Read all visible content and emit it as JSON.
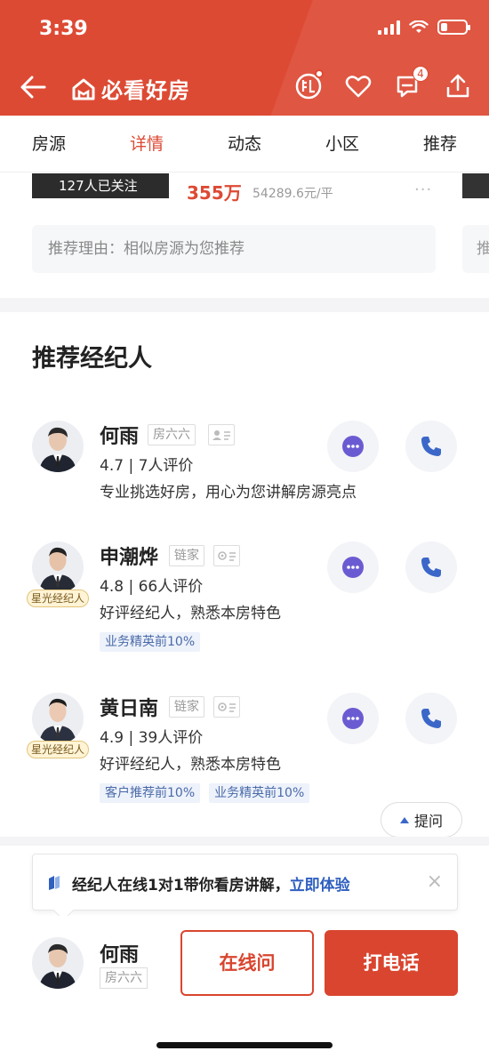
{
  "status_bar": {
    "time": "3:39"
  },
  "app": {
    "logo_text": "必看好房"
  },
  "header": {
    "message_count": "4"
  },
  "tabs": [
    {
      "label": "房源",
      "active": false
    },
    {
      "label": "详情",
      "active": true
    },
    {
      "label": "动态",
      "active": false
    },
    {
      "label": "小区",
      "active": false
    },
    {
      "label": "推荐",
      "active": false
    }
  ],
  "prev_listing": {
    "followers": "127人已关注",
    "price": "355万",
    "unit_price": "54289.6元/平",
    "more": "···",
    "reason": "推荐理由：相似房源为您推荐",
    "reason_next": "推"
  },
  "agents_section": {
    "title": "推荐经纪人",
    "agents": [
      {
        "name": "何雨",
        "brand": "房六六",
        "rating": "4.7 | 7人评价",
        "description": "专业挑选好房，用心为您讲解房源亮点",
        "badge": "",
        "tags": []
      },
      {
        "name": "申潮烨",
        "brand": "链家",
        "rating": "4.8 | 66人评价",
        "description": "好评经纪人，熟悉本房特色",
        "badge": "星光经纪人",
        "tags": [
          "业务精英前10%"
        ]
      },
      {
        "name": "黄日南",
        "brand": "链家",
        "rating": "4.9 | 39人评价",
        "description": "好评经纪人，熟悉本房特色",
        "badge": "星光经纪人",
        "tags": [
          "客户推荐前10%",
          "业务精英前10%"
        ]
      }
    ]
  },
  "ask_button": {
    "label": "提问"
  },
  "promo": {
    "text": "经纪人在线1对1带你看房讲解，",
    "link": "立即体验",
    "close": "×"
  },
  "bottom_bar": {
    "agent_name": "何雨",
    "agent_brand": "房六六",
    "online_label": "在线问",
    "call_label": "打电话"
  },
  "colors": {
    "brand_red": "#dd4a34",
    "chat_purple": "#6b5bd2",
    "phone_blue": "#3b67c9",
    "link_blue": "#2f5fbf"
  }
}
